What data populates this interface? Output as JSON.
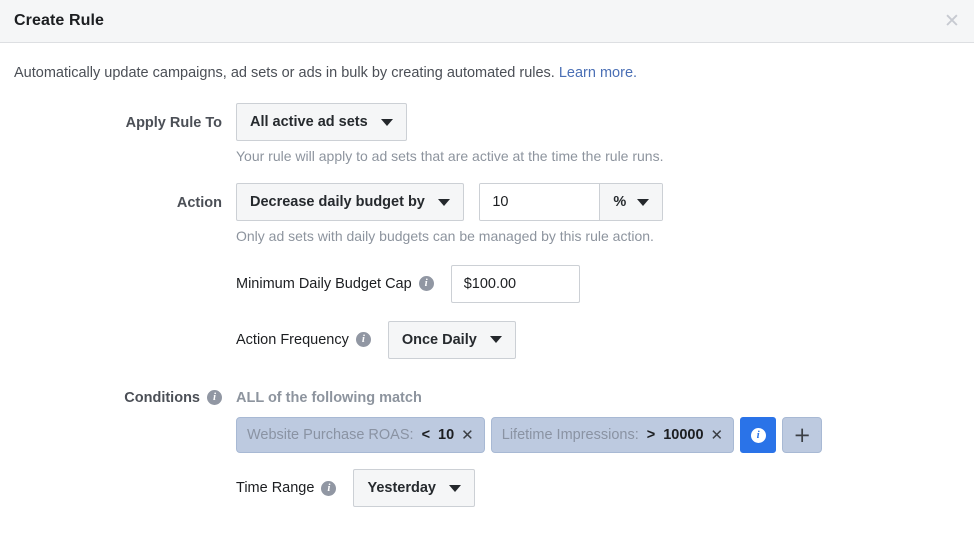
{
  "dialog": {
    "title": "Create Rule",
    "close_icon": "close-icon"
  },
  "intro": {
    "text": "Automatically update campaigns, ad sets or ads in bulk by creating automated rules. ",
    "link_text": "Learn more."
  },
  "apply_rule_to": {
    "label": "Apply Rule To",
    "value": "All active ad sets",
    "helper": "Your rule will apply to ad sets that are active at the time the rule runs."
  },
  "action": {
    "label": "Action",
    "value": "Decrease daily budget by",
    "amount": "10",
    "unit": "%",
    "helper": "Only ad sets with daily budgets can be managed by this rule action."
  },
  "min_budget_cap": {
    "label": "Minimum Daily Budget Cap",
    "info_icon": "info-icon",
    "value": "$100.00"
  },
  "action_frequency": {
    "label": "Action Frequency",
    "info_icon": "info-icon",
    "value": "Once Daily"
  },
  "conditions": {
    "label": "Conditions",
    "info_icon": "info-icon",
    "match_text": "ALL of the following match",
    "chips": [
      {
        "name": "Website Purchase ROAS:",
        "operator": "<",
        "value": "10",
        "remove_icon": "close-icon"
      },
      {
        "name": "Lifetime Impressions:",
        "operator": ">",
        "value": "10000",
        "remove_icon": "close-icon"
      }
    ],
    "info_button_icon": "info-icon",
    "add_button_label": "+"
  },
  "time_range": {
    "label": "Time Range",
    "info_icon": "info-icon",
    "value": "Yesterday"
  },
  "colors": {
    "accent_blue": "#2a73e8",
    "link_blue": "#4a6fb5",
    "chip_bg": "#bdcae0",
    "header_bg": "#f5f6f7"
  }
}
